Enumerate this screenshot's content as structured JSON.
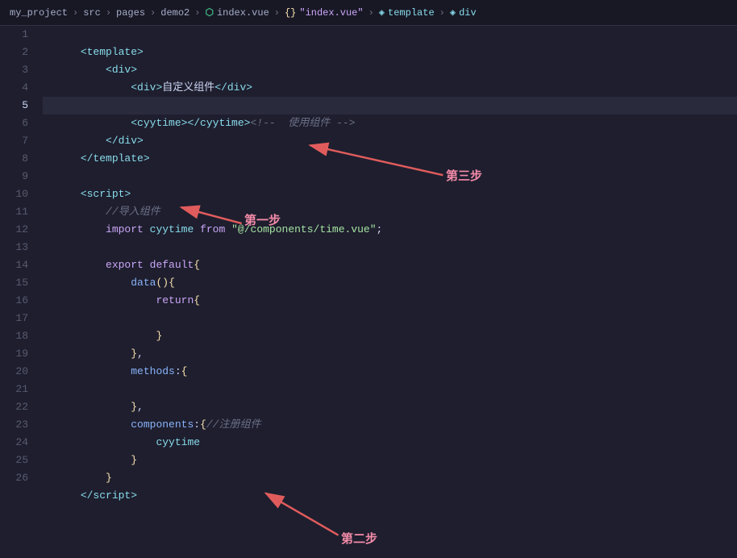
{
  "breadcrumb": {
    "parts": [
      {
        "text": "my_project",
        "type": "plain"
      },
      {
        "text": ">",
        "type": "sep"
      },
      {
        "text": "src",
        "type": "plain"
      },
      {
        "text": ">",
        "type": "sep"
      },
      {
        "text": "pages",
        "type": "plain"
      },
      {
        "text": ">",
        "type": "sep"
      },
      {
        "text": "demo2",
        "type": "plain"
      },
      {
        "text": ">",
        "type": "sep"
      },
      {
        "text": "index.vue",
        "type": "vue"
      },
      {
        "text": ">",
        "type": "sep"
      },
      {
        "text": "{}",
        "type": "brace"
      },
      {
        "text": "\"index.vue\"",
        "type": "file"
      },
      {
        "text": ">",
        "type": "sep"
      },
      {
        "text": "template",
        "type": "template"
      },
      {
        "text": ">",
        "type": "sep"
      },
      {
        "text": "div",
        "type": "tag"
      }
    ]
  },
  "lines": [
    {
      "num": 1,
      "content": "template_open"
    },
    {
      "num": 2,
      "content": "div_open"
    },
    {
      "num": 3,
      "content": "div_custom"
    },
    {
      "num": 4,
      "content": "div_dashes"
    },
    {
      "num": 5,
      "content": "cyytime_use",
      "highlighted": true
    },
    {
      "num": 6,
      "content": "div_close"
    },
    {
      "num": 7,
      "content": "template_close"
    },
    {
      "num": 8,
      "content": "empty"
    },
    {
      "num": 9,
      "content": "script_open"
    },
    {
      "num": 10,
      "content": "comment_import"
    },
    {
      "num": 11,
      "content": "import_line"
    },
    {
      "num": 12,
      "content": "empty"
    },
    {
      "num": 13,
      "content": "export_default"
    },
    {
      "num": 14,
      "content": "data_func"
    },
    {
      "num": 15,
      "content": "return_open"
    },
    {
      "num": 16,
      "content": "empty"
    },
    {
      "num": 17,
      "content": "return_close"
    },
    {
      "num": 18,
      "content": "data_close"
    },
    {
      "num": 19,
      "content": "methods"
    },
    {
      "num": 20,
      "content": "empty"
    },
    {
      "num": 21,
      "content": "methods_close"
    },
    {
      "num": 22,
      "content": "components"
    },
    {
      "num": 23,
      "content": "cyytime_name"
    },
    {
      "num": 24,
      "content": "components_close"
    },
    {
      "num": 25,
      "content": "export_close"
    },
    {
      "num": 26,
      "content": "script_close"
    }
  ],
  "annotations": {
    "step1": "第一步",
    "step2": "第二步",
    "step3": "第三步"
  }
}
